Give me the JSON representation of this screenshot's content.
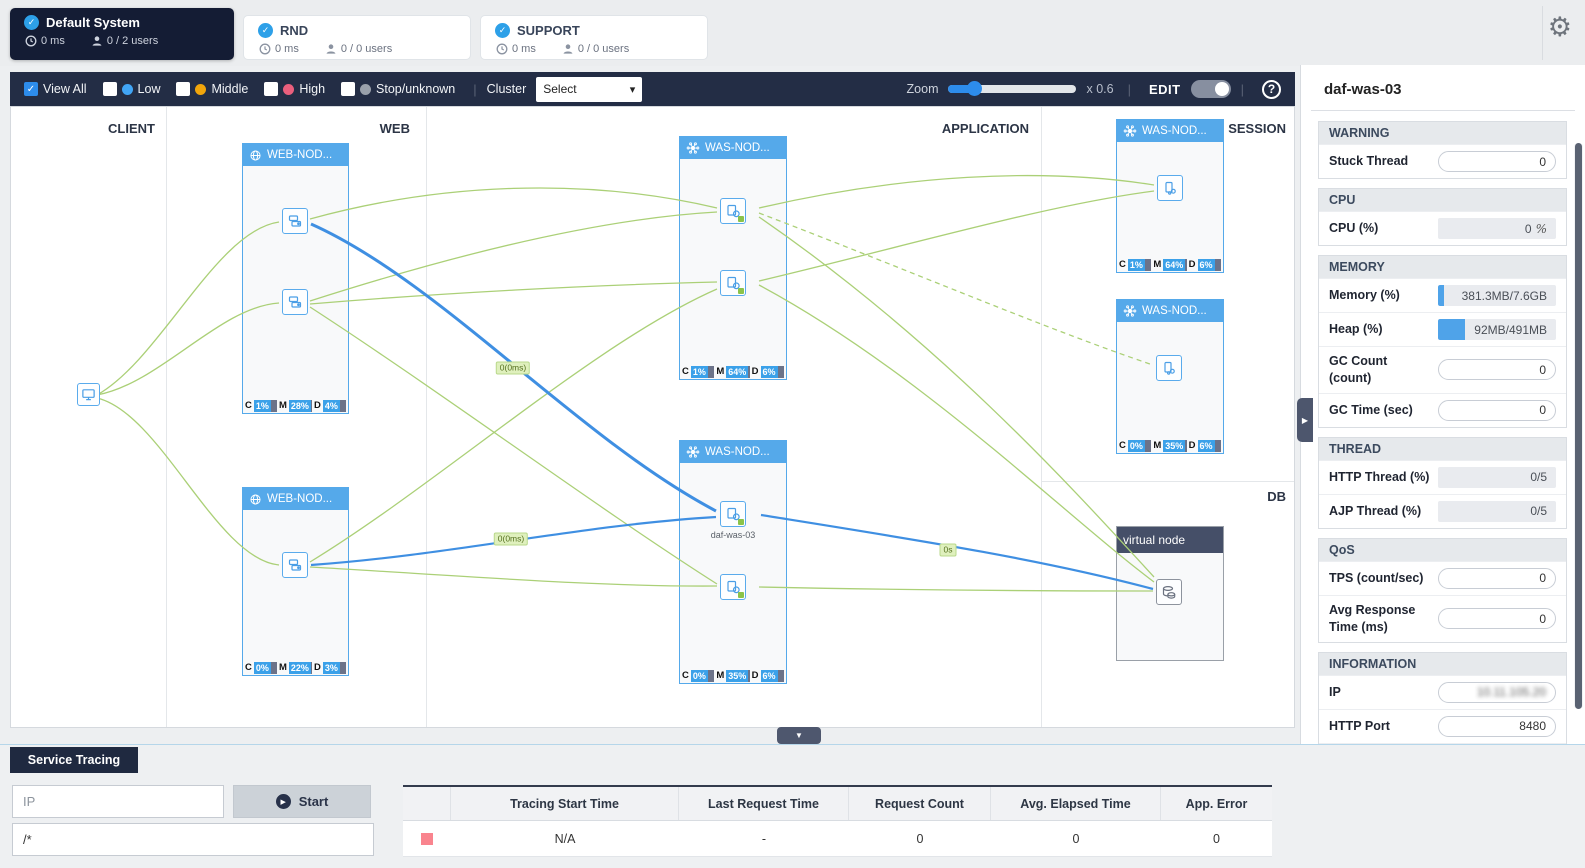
{
  "header": {
    "systems": [
      {
        "name": "Default System",
        "latency": "0 ms",
        "users": "0 / 2 users",
        "selected": true
      },
      {
        "name": "RND",
        "latency": "0 ms",
        "users": "0 / 0 users",
        "selected": false
      },
      {
        "name": "SUPPORT",
        "latency": "0 ms",
        "users": "0 / 0 users",
        "selected": false
      }
    ]
  },
  "toolbar": {
    "view_all": "View All",
    "low": "Low",
    "middle": "Middle",
    "high": "High",
    "stop": "Stop/unknown",
    "cluster": "Cluster",
    "select_value": "Select",
    "zoom_label": "Zoom",
    "zoom_value": "x 0.6",
    "edit_label": "EDIT",
    "help_label": "?",
    "status_colors": {
      "low": "#41a5f6",
      "middle": "#f1a50b",
      "high": "#ea5f7d",
      "stop": "#9aa1ab",
      "checked": "#2d8ceb"
    }
  },
  "topology": {
    "column_labels": {
      "client": "CLIENT",
      "web": "WEB",
      "application": "APPLICATION",
      "session": "SESSION",
      "db": "DB"
    },
    "stat_keys": {
      "c": "C",
      "m": "M",
      "d": "D"
    },
    "boxes": [
      {
        "title": "WEB-NOD...",
        "stats": {
          "c": "1%",
          "m": "28%",
          "d": "4%"
        }
      },
      {
        "title": "WEB-NOD...",
        "stats": {
          "c": "0%",
          "m": "22%",
          "d": "3%"
        }
      },
      {
        "title": "WAS-NOD...",
        "stats": {
          "c": "1%",
          "m": "64%",
          "d": "6%"
        }
      },
      {
        "title": "WAS-NOD...",
        "node_label": "daf-was-03",
        "stats": {
          "c": "0%",
          "m": "35%",
          "d": "6%"
        }
      },
      {
        "title": "WAS-NOD...",
        "stats": {
          "c": "1%",
          "m": "64%",
          "d": "6%"
        }
      },
      {
        "title": "WAS-NOD...",
        "stats": {
          "c": "0%",
          "m": "35%",
          "d": "6%"
        }
      },
      {
        "title": "virtual node"
      }
    ],
    "edge_labels": [
      "0(0ms)",
      "0(0ms)",
      "0s"
    ],
    "edge_colors": {
      "normal": "#abd077",
      "active": "#3f8fe2"
    }
  },
  "detail": {
    "title": "daf-was-03",
    "warning": {
      "header": "WARNING",
      "stuck_label": "Stuck Thread",
      "stuck_value": "0"
    },
    "cpu": {
      "header": "CPU",
      "label": "CPU (%)",
      "value": "0",
      "unit": "%"
    },
    "memory": {
      "header": "MEMORY",
      "memory_label": "Memory (%)",
      "memory_value": "381.3MB/7.6GB",
      "memory_fill": 5,
      "heap_label": "Heap (%)",
      "heap_value": "92MB/491MB",
      "heap_fill": 23,
      "gc_count_label": "GC Count (count)",
      "gc_count_value": "0",
      "gc_time_label": "GC Time (sec)",
      "gc_time_value": "0"
    },
    "thread": {
      "header": "THREAD",
      "http_label": "HTTP Thread (%)",
      "http_value": "0/5",
      "ajp_label": "AJP Thread (%)",
      "ajp_value": "0/5"
    },
    "qos": {
      "header": "QoS",
      "tps_label": "TPS (count/sec)",
      "tps_value": "0",
      "avg_label": "Avg Response Time (ms)",
      "avg_value": "0"
    },
    "info": {
      "header": "INFORMATION",
      "ip_label": "IP",
      "ip_value": "10.11.105.20",
      "ip_redacted": true,
      "port_label": "HTTP Port",
      "port_value": "8480"
    }
  },
  "tracing": {
    "tab": "Service Tracing",
    "ip_placeholder": "IP",
    "start_label": "Start",
    "url_value": "/*",
    "table": {
      "headers": {
        "start": "Tracing Start Time",
        "last": "Last Request Time",
        "count": "Request Count",
        "elapsed": "Avg. Elapsed Time",
        "error": "App. Error"
      },
      "row": {
        "swatch_color": "#f9848e",
        "start": "N/A",
        "last": "-",
        "count": "0",
        "elapsed": "0",
        "error": "0"
      }
    }
  }
}
